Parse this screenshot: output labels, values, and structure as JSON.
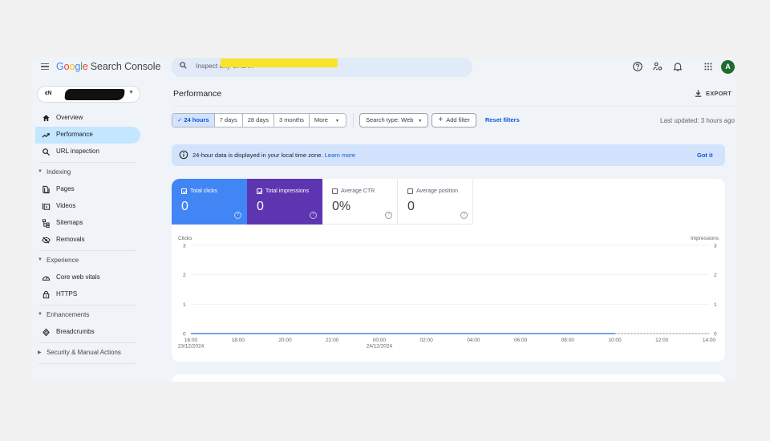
{
  "app": {
    "logo": {
      "google": [
        "G",
        "o",
        "o",
        "g",
        "l",
        "e"
      ],
      "product": "Search Console"
    },
    "search": {
      "placeholder": "Inspect any URL in",
      "redacted": true
    },
    "top_icons": [
      "help-icon",
      "search-console-users-icon",
      "notifications-icon",
      "apps-grid-icon"
    ],
    "avatar_letter": "A"
  },
  "sidebar": {
    "property": {
      "icon_text": "ꞓN",
      "name_redacted": true
    },
    "items": [
      {
        "type": "item",
        "label": "Overview",
        "icon": "home-icon",
        "active": false
      },
      {
        "type": "item",
        "label": "Performance",
        "icon": "trending-up-icon",
        "active": true
      },
      {
        "type": "item",
        "label": "URL inspection",
        "icon": "search-icon",
        "active": false
      },
      {
        "type": "divider"
      },
      {
        "type": "section",
        "label": "Indexing",
        "expanded": true
      },
      {
        "type": "item",
        "label": "Pages",
        "icon": "pages-icon",
        "active": false
      },
      {
        "type": "item",
        "label": "Videos",
        "icon": "video-icon",
        "active": false
      },
      {
        "type": "item",
        "label": "Sitemaps",
        "icon": "sitemap-icon",
        "active": false
      },
      {
        "type": "item",
        "label": "Removals",
        "icon": "removals-icon",
        "active": false
      },
      {
        "type": "divider"
      },
      {
        "type": "section",
        "label": "Experience",
        "expanded": true
      },
      {
        "type": "item",
        "label": "Core web vitals",
        "icon": "speed-gauge-icon",
        "active": false
      },
      {
        "type": "item",
        "label": "HTTPS",
        "icon": "lock-icon",
        "active": false
      },
      {
        "type": "divider"
      },
      {
        "type": "section",
        "label": "Enhancements",
        "expanded": true
      },
      {
        "type": "item",
        "label": "Breadcrumbs",
        "icon": "breadcrumbs-icon",
        "active": false
      },
      {
        "type": "divider"
      },
      {
        "type": "section",
        "label": "Security & Manual Actions",
        "expanded": false
      },
      {
        "type": "divider"
      }
    ]
  },
  "main": {
    "title": "Performance",
    "export_label": "EXPORT",
    "date_ranges": [
      {
        "label": "24 hours",
        "selected": true
      },
      {
        "label": "7 days",
        "selected": false
      },
      {
        "label": "28 days",
        "selected": false
      },
      {
        "label": "3 months",
        "selected": false
      },
      {
        "label": "More",
        "selected": false,
        "dropdown": true
      }
    ],
    "search_type_label": "Search type: Web",
    "add_filter_label": "Add filter",
    "reset_filters_label": "Reset filters",
    "last_updated": "Last updated: 3 hours ago",
    "banner": {
      "text": "24-hour data is displayed in your local time zone.",
      "link": "Learn more",
      "dismiss": "Got it"
    },
    "metrics": [
      {
        "key": "clicks",
        "label": "Total clicks",
        "value": "0",
        "checked": true,
        "color": "#4285f4"
      },
      {
        "key": "impr",
        "label": "Total impressions",
        "value": "0",
        "checked": true,
        "color": "#5e35b1"
      },
      {
        "key": "ctr",
        "label": "Average CTR",
        "value": "0%",
        "checked": false
      },
      {
        "key": "pos",
        "label": "Average position",
        "value": "0",
        "checked": false
      }
    ]
  },
  "chart_data": {
    "type": "line",
    "title": "",
    "ylabel_left": "Clicks",
    "ylabel_right": "Impressions",
    "ylim": [
      0,
      3
    ],
    "yticks": [
      0,
      1,
      2,
      3
    ],
    "grid": true,
    "x": [
      "16:00",
      "17:00",
      "18:00",
      "19:00",
      "20:00",
      "21:00",
      "22:00",
      "23:00",
      "00:00",
      "01:00",
      "02:00",
      "03:00",
      "04:00",
      "05:00",
      "06:00",
      "07:00",
      "08:00",
      "09:00",
      "10:00",
      "11:00",
      "12:00",
      "13:00",
      "14:00"
    ],
    "xtick_labels": [
      {
        "time": "16:00",
        "date": "23/12/2024"
      },
      {
        "time": "18:00",
        "date": ""
      },
      {
        "time": "20:00",
        "date": ""
      },
      {
        "time": "22:00",
        "date": ""
      },
      {
        "time": "00:00",
        "date": "24/12/2024"
      },
      {
        "time": "02:00",
        "date": ""
      },
      {
        "time": "04:00",
        "date": ""
      },
      {
        "time": "06:00",
        "date": ""
      },
      {
        "time": "08:00",
        "date": ""
      },
      {
        "time": "10:00",
        "date": ""
      },
      {
        "time": "12:00",
        "date": ""
      },
      {
        "time": "14:00",
        "date": ""
      }
    ],
    "series": [
      {
        "name": "Clicks",
        "color": "#4285f4",
        "values": [
          0,
          0,
          0,
          0,
          0,
          0,
          0,
          0,
          0,
          0,
          0,
          0,
          0,
          0,
          0,
          0,
          0,
          0,
          0
        ],
        "axis": "left"
      },
      {
        "name": "Impressions",
        "color": "#5e35b1",
        "values": [
          0,
          0,
          0,
          0,
          0,
          0,
          0,
          0,
          0,
          0,
          0,
          0,
          0,
          0,
          0,
          0,
          0,
          0,
          0
        ],
        "axis": "right"
      }
    ],
    "incomplete_after": "10:00"
  }
}
